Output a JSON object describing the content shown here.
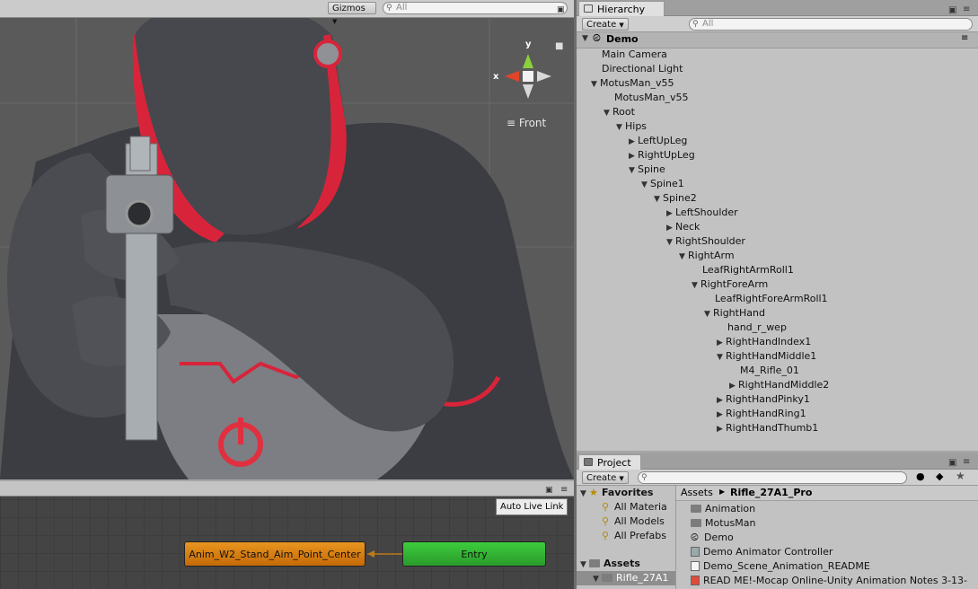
{
  "scene": {
    "gizmos_label": "Gizmos",
    "search_placeholder": "All",
    "orientation_label": "Front",
    "axis_y": "y",
    "axis_x": "x"
  },
  "animator": {
    "auto_live_link_label": "Auto Live Link",
    "states": {
      "anim": "Anim_W2_Stand_Aim_Point_Center",
      "entry": "Entry"
    }
  },
  "hierarchy": {
    "tab_label": "Hierarchy",
    "create_label": "Create",
    "search_placeholder": "All",
    "scene_name": "Demo",
    "items": [
      {
        "label": "Main Camera",
        "depth": 1,
        "arrow": ""
      },
      {
        "label": "Directional Light",
        "depth": 1,
        "arrow": ""
      },
      {
        "label": "MotusMan_v55",
        "depth": 1,
        "arrow": "open"
      },
      {
        "label": "MotusMan_v55",
        "depth": 2,
        "arrow": ""
      },
      {
        "label": "Root",
        "depth": 2,
        "arrow": "open"
      },
      {
        "label": "Hips",
        "depth": 3,
        "arrow": "open"
      },
      {
        "label": "LeftUpLeg",
        "depth": 4,
        "arrow": "closed"
      },
      {
        "label": "RightUpLeg",
        "depth": 4,
        "arrow": "closed"
      },
      {
        "label": "Spine",
        "depth": 4,
        "arrow": "open"
      },
      {
        "label": "Spine1",
        "depth": 5,
        "arrow": "open"
      },
      {
        "label": "Spine2",
        "depth": 6,
        "arrow": "open"
      },
      {
        "label": "LeftShoulder",
        "depth": 7,
        "arrow": "closed"
      },
      {
        "label": "Neck",
        "depth": 7,
        "arrow": "closed"
      },
      {
        "label": "RightShoulder",
        "depth": 7,
        "arrow": "open"
      },
      {
        "label": "RightArm",
        "depth": 8,
        "arrow": "open"
      },
      {
        "label": "LeafRightArmRoll1",
        "depth": 9,
        "arrow": ""
      },
      {
        "label": "RightForeArm",
        "depth": 9,
        "arrow": "open"
      },
      {
        "label": "LeafRightForeArmRoll1",
        "depth": 10,
        "arrow": ""
      },
      {
        "label": "RightHand",
        "depth": 10,
        "arrow": "open"
      },
      {
        "label": "hand_r_wep",
        "depth": 11,
        "arrow": ""
      },
      {
        "label": "RightHandIndex1",
        "depth": 11,
        "arrow": "closed"
      },
      {
        "label": "RightHandMiddle1",
        "depth": 11,
        "arrow": "open"
      },
      {
        "label": "M4_Rifle_01",
        "depth": 12,
        "arrow": ""
      },
      {
        "label": "RightHandMiddle2",
        "depth": 12,
        "arrow": "closed"
      },
      {
        "label": "RightHandPinky1",
        "depth": 11,
        "arrow": "closed"
      },
      {
        "label": "RightHandRing1",
        "depth": 11,
        "arrow": "closed"
      },
      {
        "label": "RightHandThumb1",
        "depth": 11,
        "arrow": "closed"
      }
    ]
  },
  "project": {
    "tab_label": "Project",
    "create_label": "Create",
    "favorites_label": "Favorites",
    "favorites": [
      "All Materia",
      "All Models",
      "All Prefabs"
    ],
    "assets_label": "Assets",
    "assets_child": "Rifle_27A1",
    "breadcrumb_root": "Assets",
    "breadcrumb_current": "Rifle_27A1_Pro",
    "files": [
      {
        "label": "Animation",
        "icon": "folder-icon"
      },
      {
        "label": "MotusMan",
        "icon": "folder-icon"
      },
      {
        "label": "Demo",
        "icon": "unity-scene-icon"
      },
      {
        "label": "Demo Animator Controller",
        "icon": "animator-controller-icon"
      },
      {
        "label": "Demo_Scene_Animation_README",
        "icon": "text-file-icon"
      },
      {
        "label": "READ ME!-Mocap Online-Unity Animation Notes 3-13-",
        "icon": "pdf-icon"
      }
    ]
  },
  "colors": {
    "state_orange": "#d9820f",
    "state_green": "#37b437",
    "character_red": "#d8243a"
  }
}
